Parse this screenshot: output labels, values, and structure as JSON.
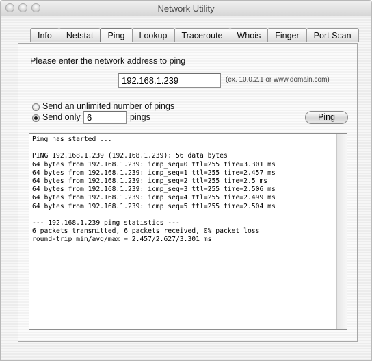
{
  "window": {
    "title": "Network Utility"
  },
  "tabs": [
    {
      "label": "Info"
    },
    {
      "label": "Netstat"
    },
    {
      "label": "Ping"
    },
    {
      "label": "Lookup"
    },
    {
      "label": "Traceroute"
    },
    {
      "label": "Whois"
    },
    {
      "label": "Finger"
    },
    {
      "label": "Port Scan"
    }
  ],
  "active_tab": "Ping",
  "ping": {
    "prompt": "Please enter the network address to ping",
    "address_value": "192.168.1.239",
    "address_hint": "(ex. 10.0.2.1 or www.domain.com)",
    "option_unlimited": "Send an unlimited number of pings",
    "option_count": "Send only",
    "count_value": "6",
    "count_suffix": "pings",
    "button_label": "Ping",
    "selected_option": "count"
  },
  "output": {
    "lines": [
      "Ping has started ...",
      "",
      "PING 192.168.1.239 (192.168.1.239): 56 data bytes",
      "64 bytes from 192.168.1.239: icmp_seq=0 ttl=255 time=3.301 ms",
      "64 bytes from 192.168.1.239: icmp_seq=1 ttl=255 time=2.457 ms",
      "64 bytes from 192.168.1.239: icmp_seq=2 ttl=255 time=2.5 ms",
      "64 bytes from 192.168.1.239: icmp_seq=3 ttl=255 time=2.506 ms",
      "64 bytes from 192.168.1.239: icmp_seq=4 ttl=255 time=2.499 ms",
      "64 bytes from 192.168.1.239: icmp_seq=5 ttl=255 time=2.504 ms",
      "",
      "--- 192.168.1.239 ping statistics ---",
      "6 packets transmitted, 6 packets received, 0% packet loss",
      "round-trip min/avg/max = 2.457/2.627/3.301 ms"
    ]
  }
}
